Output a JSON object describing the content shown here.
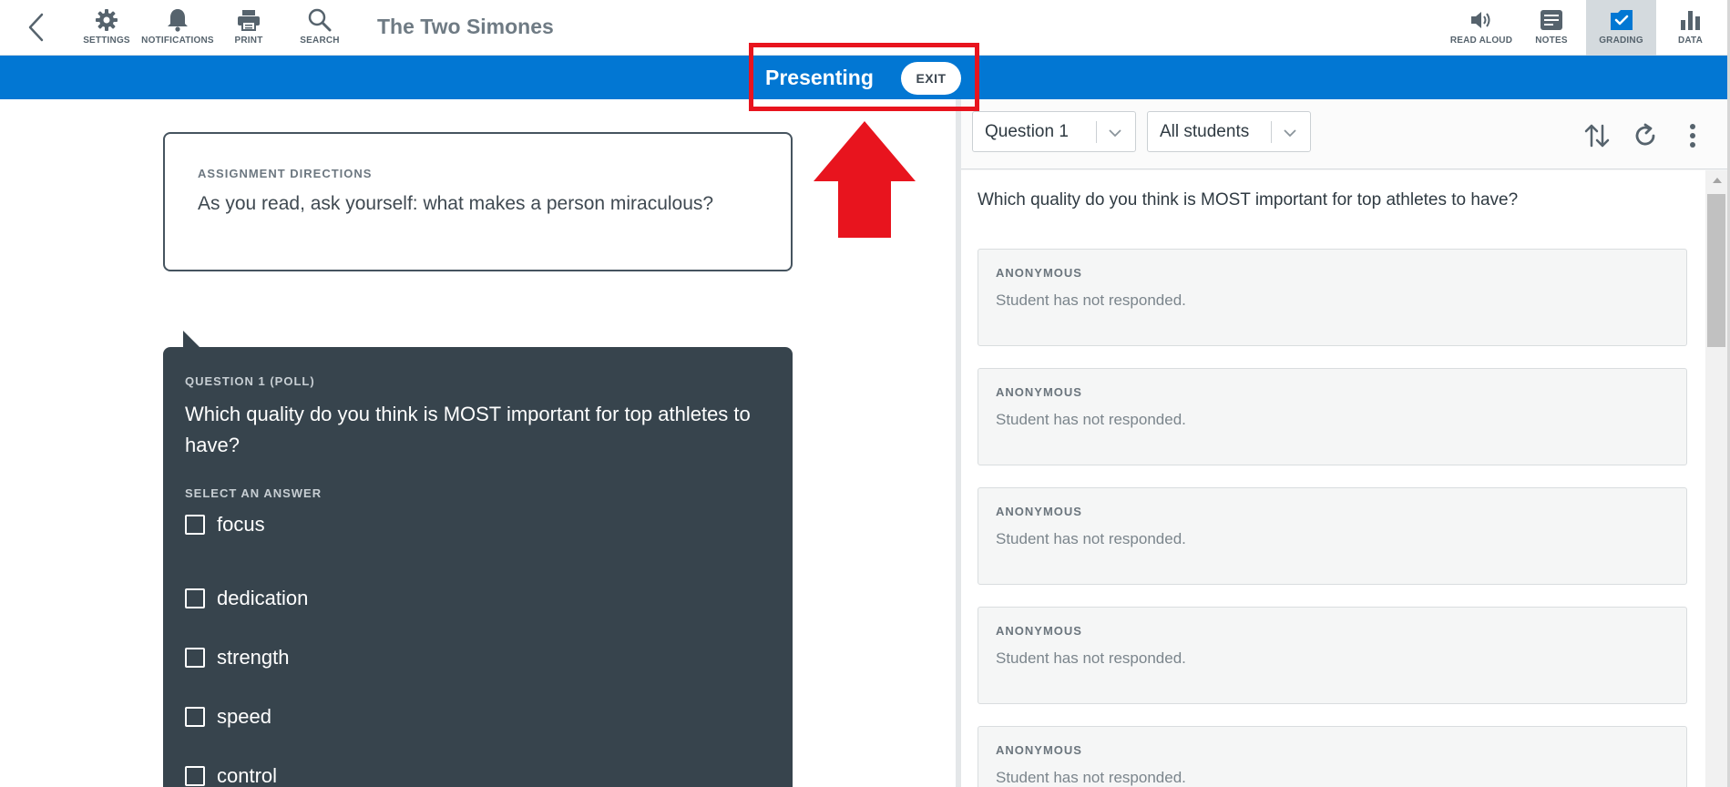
{
  "toolbar": {
    "title": "The Two Simones",
    "left_tools": [
      {
        "label": "SETTINGS",
        "icon": "gear-icon"
      },
      {
        "label": "NOTIFICATIONS",
        "icon": "bell-icon"
      },
      {
        "label": "PRINT",
        "icon": "printer-icon"
      },
      {
        "label": "SEARCH",
        "icon": "search-icon"
      }
    ],
    "right_tools": [
      {
        "label": "READ ALOUD",
        "icon": "speaker-icon"
      },
      {
        "label": "NOTES",
        "icon": "notes-icon"
      },
      {
        "label": "GRADING",
        "icon": "grading-icon",
        "active": true
      },
      {
        "label": "DATA",
        "icon": "bar-chart-icon"
      }
    ]
  },
  "banner": {
    "text": "Presenting",
    "exit_label": "EXIT",
    "color": "#0277d3"
  },
  "annotation": {
    "color": "#e8141e"
  },
  "directions": {
    "caption": "ASSIGNMENT DIRECTIONS",
    "text": "As you read, ask yourself: what makes a person miraculous?"
  },
  "question": {
    "caption": "QUESTION 1 (POLL)",
    "text": "Which quality do you think is MOST important for top athletes to have?",
    "select_caption": "SELECT AN ANSWER",
    "answers": [
      "focus",
      "dedication",
      "strength",
      "speed",
      "control"
    ]
  },
  "grading": {
    "question_select": "Question 1",
    "student_select": "All students",
    "question_text": "Which quality do you think is MOST important for top athletes to have?",
    "responses": [
      {
        "name": "ANONYMOUS",
        "status": "Student has not responded."
      },
      {
        "name": "ANONYMOUS",
        "status": "Student has not responded."
      },
      {
        "name": "ANONYMOUS",
        "status": "Student has not responded."
      },
      {
        "name": "ANONYMOUS",
        "status": "Student has not responded."
      },
      {
        "name": "ANONYMOUS",
        "status": "Student has not responded."
      }
    ]
  }
}
